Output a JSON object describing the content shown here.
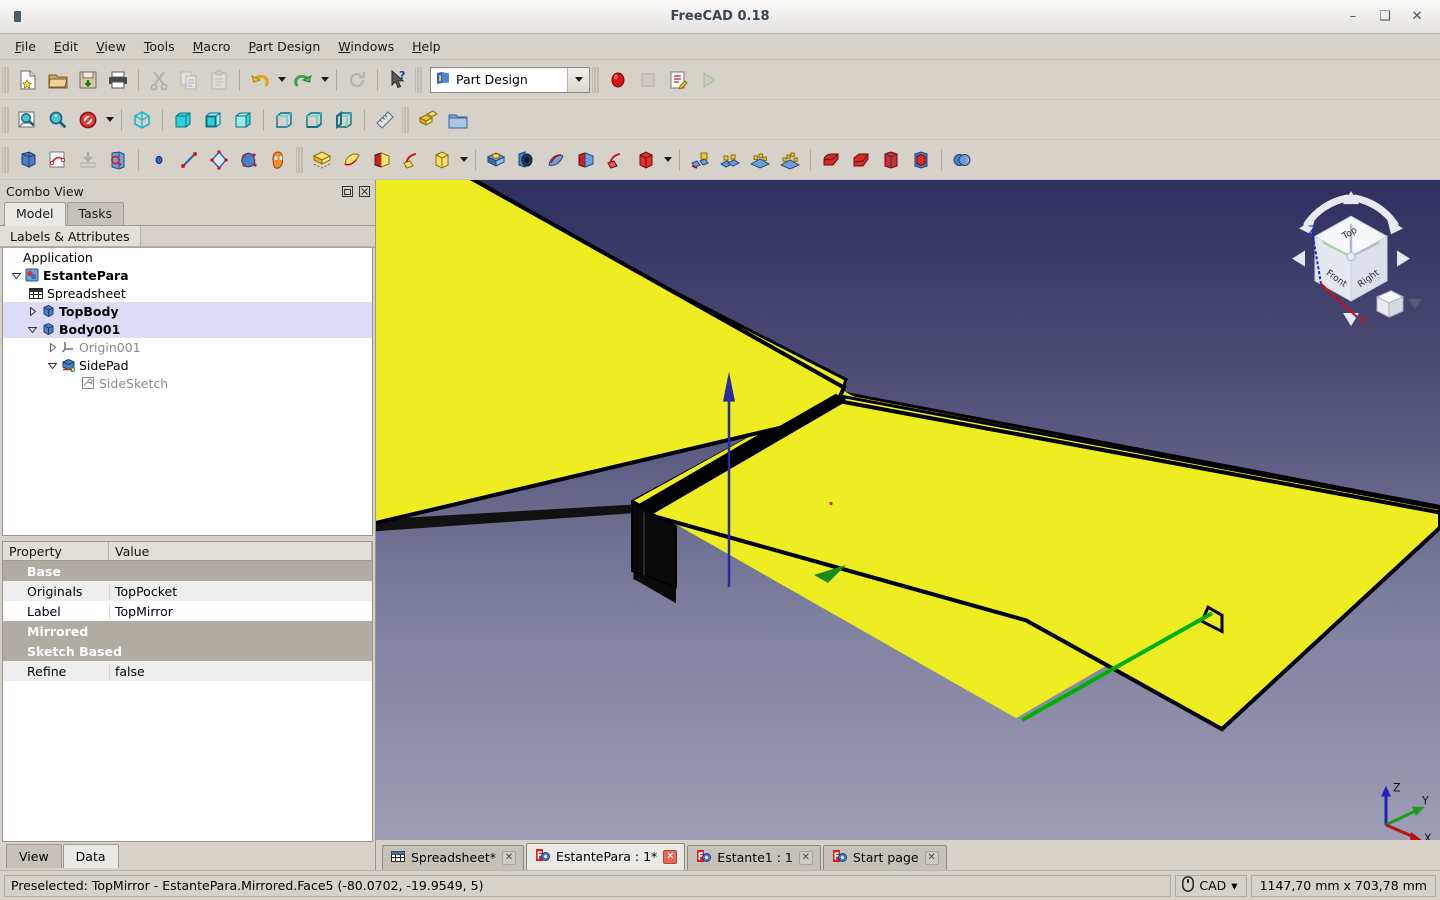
{
  "window": {
    "title": "FreeCAD 0.18",
    "app_icon": "freecad-icon",
    "minimize": "–",
    "maximize": "❑",
    "close": "✕"
  },
  "menubar": {
    "items": [
      {
        "label": "File",
        "mnemonic": "F"
      },
      {
        "label": "Edit",
        "mnemonic": "E"
      },
      {
        "label": "View",
        "mnemonic": "V"
      },
      {
        "label": "Tools",
        "mnemonic": "T"
      },
      {
        "label": "Macro",
        "mnemonic": "M"
      },
      {
        "label": "Part Design",
        "mnemonic": "P"
      },
      {
        "label": "Windows",
        "mnemonic": "W"
      },
      {
        "label": "Help",
        "mnemonic": "H"
      }
    ]
  },
  "toolbars": {
    "workbench_selector": {
      "value": "Part Design",
      "icon": "workbench-icon"
    },
    "file_tools": [
      "new-document-icon",
      "open-document-icon",
      "save-document-icon",
      "print-icon"
    ],
    "edit_tools": [
      "cut-icon",
      "copy-icon",
      "paste-icon"
    ],
    "history_tools": [
      "undo-icon",
      "redo-icon",
      "refresh-icon",
      "whats-this-icon"
    ],
    "macro_tools": [
      "macro-record-icon",
      "macro-stop-icon",
      "macro-edit-icon",
      "macro-execute-icon"
    ],
    "view_tools": [
      "fit-all-icon",
      "fit-selection-icon",
      "draw-style-icon",
      "isometric-view-icon",
      "front-view-icon",
      "top-view-icon",
      "right-view-icon",
      "rear-view-icon",
      "bottom-view-icon",
      "left-view-icon",
      "measure-icon"
    ],
    "structure_tools": [
      "create-part-icon",
      "create-group-icon"
    ],
    "partdesign_body_tools": [
      "create-body-icon",
      "create-sketch-icon",
      "attach-sketch-icon",
      "validate-sketch-icon"
    ],
    "partdesign_datum_tools": [
      "datum-point-icon",
      "datum-line-icon",
      "datum-plane-icon",
      "shape-binder-icon",
      "sub-shape-binder-icon"
    ],
    "partdesign_additive_tools": [
      "pad-icon",
      "revolution-icon",
      "additive-loft-icon",
      "additive-pipe-icon",
      "additive-primitive-icon"
    ],
    "partdesign_subtractive_tools": [
      "pocket-icon",
      "hole-icon",
      "groove-icon",
      "subtractive-loft-icon",
      "subtractive-pipe-icon",
      "subtractive-primitive-icon"
    ],
    "partdesign_transform_tools": [
      "mirrored-icon",
      "linear-pattern-icon",
      "polar-pattern-icon",
      "multi-transform-icon"
    ],
    "partdesign_dressup_tools": [
      "fillet-icon",
      "chamfer-icon",
      "draft-icon",
      "thickness-icon"
    ],
    "partdesign_boolean_tools": [
      "boolean-operation-icon"
    ]
  },
  "combo_view": {
    "title": "Combo View",
    "float_icon": "undock-icon",
    "close_icon": "close-icon",
    "tabs": [
      {
        "label": "Model",
        "active": true
      },
      {
        "label": "Tasks",
        "active": false
      }
    ],
    "tree_column_header": "Labels & Attributes",
    "tree": [
      {
        "label": "Application",
        "indent": 0,
        "twist": "",
        "icon": "",
        "bold": false,
        "dim": false,
        "selected": false
      },
      {
        "label": "EstantePara",
        "indent": 1,
        "twist": "open",
        "icon": "document-icon",
        "bold": true,
        "dim": false,
        "selected": false
      },
      {
        "label": "Spreadsheet",
        "indent": 2,
        "twist": "",
        "icon": "spreadsheet-icon",
        "bold": false,
        "dim": false,
        "selected": false
      },
      {
        "label": "TopBody",
        "indent": 2,
        "twist": "closed",
        "icon": "body-icon",
        "bold": true,
        "dim": false,
        "selected": true
      },
      {
        "label": "Body001",
        "indent": 2,
        "twist": "open",
        "icon": "body-icon",
        "bold": true,
        "dim": false,
        "selected": true
      },
      {
        "label": "Origin001",
        "indent": 3,
        "twist": "closed",
        "icon": "origin-icon",
        "bold": false,
        "dim": true,
        "selected": false
      },
      {
        "label": "SidePad",
        "indent": 3,
        "twist": "open",
        "icon": "pad-icon",
        "bold": false,
        "dim": false,
        "selected": false
      },
      {
        "label": "SideSketch",
        "indent": 4,
        "twist": "",
        "icon": "sketch-icon",
        "bold": false,
        "dim": true,
        "selected": false
      }
    ],
    "property_headers": {
      "property": "Property",
      "value": "Value"
    },
    "properties": [
      {
        "kind": "group",
        "key": "Base",
        "value": ""
      },
      {
        "kind": "row",
        "key": "Originals",
        "value": "TopPocket",
        "alt": true
      },
      {
        "kind": "row",
        "key": "Label",
        "value": "TopMirror",
        "alt": false
      },
      {
        "kind": "group",
        "key": "Mirrored",
        "value": ""
      },
      {
        "kind": "group",
        "key": "Sketch Based",
        "value": ""
      },
      {
        "kind": "row",
        "key": "Refine",
        "value": "false",
        "alt": true
      }
    ],
    "bottom_tabs": [
      {
        "label": "View",
        "active": false
      },
      {
        "label": "Data",
        "active": true
      }
    ]
  },
  "viewport": {
    "navigation_cube": {
      "top_face": "Top",
      "front_face": "Front",
      "right_face": "Right",
      "axis_z_label": "Z",
      "axis_x_label": "X"
    },
    "axis_cross": {
      "x": "X",
      "y": "Y",
      "z": "Z"
    },
    "colors": {
      "model_face": "#eded21",
      "model_edge": "#000000",
      "highlight_edge": "#00aa00",
      "axis_z": "#2222aa",
      "axis_y": "#118811",
      "axis_x": "#bb1111",
      "bg_top": "#2f2f5e",
      "bg_bottom": "#9c9cb4"
    }
  },
  "document_tabs": [
    {
      "label": "Spreadsheet*",
      "icon": "spreadsheet-icon",
      "active": false,
      "close": "✕"
    },
    {
      "label": "EstantePara : 1*",
      "icon": "freecad-doc-icon",
      "active": true,
      "close": "✕"
    },
    {
      "label": "Estante1 : 1",
      "icon": "freecad-doc-icon",
      "active": false,
      "close": "✕"
    },
    {
      "label": "Start page",
      "icon": "freecad-doc-icon",
      "active": false,
      "close": "✕"
    }
  ],
  "statusbar": {
    "message": "Preselected: TopMirror - EstantePara.Mirrored.Face5 (-80.0702, -19.9549, 5)",
    "navigation_style": "CAD",
    "navigation_icon": "mouse-icon",
    "navigation_caret": "▾",
    "dimensions": "1147,70 mm x 703,78 mm"
  }
}
